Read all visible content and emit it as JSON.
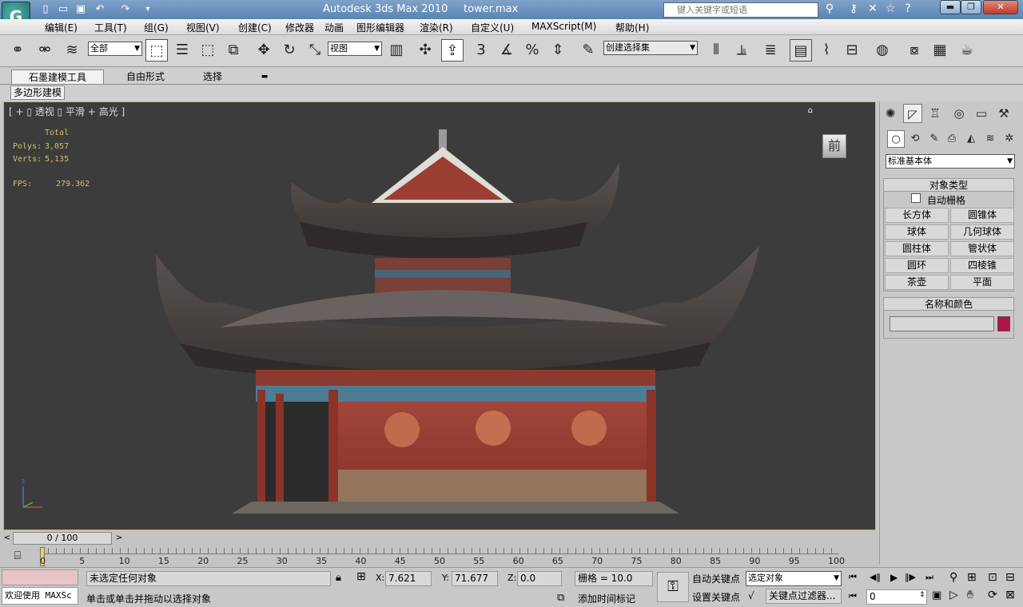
{
  "title": {
    "app": "Autodesk 3ds Max  2010",
    "file": "tower.max",
    "search_placeholder": "键入关键字或短语"
  },
  "menu": [
    "编辑(E)",
    "工具(T)",
    "组(G)",
    "视图(V)",
    "创建(C)",
    "修改器",
    "动画",
    "图形编辑器",
    "渲染(R)",
    "自定义(U)",
    "MAXScript(M)",
    "帮助(H)"
  ],
  "toolbar": {
    "selection_filter": "全部",
    "ref_coord": "视图",
    "named_selection": "创建选择集",
    "snap_angle_label": "3"
  },
  "ribbon": {
    "tabs": [
      "石墨建模工具",
      "自由形式",
      "选择"
    ],
    "active_panel": "多边形建模"
  },
  "viewport": {
    "label": "[ + ▯ 透视 ▯ 平滑 + 高光 ]",
    "stats_header": "Total",
    "polys_label": "Polys:",
    "polys": "3,057",
    "verts_label": "Verts:",
    "verts": "5,135",
    "fps_label": "FPS:",
    "fps": "279.362",
    "viewcube_face": "前",
    "axis_label": "z"
  },
  "command_panel": {
    "category": "标准基本体",
    "object_type_title": "对象类型",
    "autogrid": "自动栅格",
    "objects": [
      "长方体",
      "圆锥体",
      "球体",
      "几何球体",
      "圆柱体",
      "管状体",
      "圆环",
      "四棱锥",
      "茶壶",
      "平面"
    ],
    "name_color_title": "名称和颜色",
    "name_value": "",
    "object_color": "#b0124a"
  },
  "timeline": {
    "frame_readout": "0 / 100",
    "ticks": [
      "0",
      "5",
      "10",
      "15",
      "20",
      "25",
      "30",
      "35",
      "40",
      "45",
      "50",
      "55",
      "60",
      "65",
      "70",
      "75",
      "80",
      "85",
      "90",
      "95",
      "100"
    ]
  },
  "status": {
    "script_label": "欢迎使用 MAXSc",
    "prompt_top": "未选定任何对象",
    "prompt_bottom": "单击或单击并拖动以选择对象",
    "x_label": "X:",
    "x": "7.621",
    "y_label": "Y:",
    "y": "71.677",
    "z_label": "Z:",
    "z": "0.0",
    "grid": "栅格 = 10.0",
    "add_time_tag": "添加时间标记",
    "auto_key": "自动关键点",
    "set_key": "设置关键点",
    "key_mode": "选定对象",
    "key_filters": "关键点过滤器...",
    "current_frame": "0"
  }
}
